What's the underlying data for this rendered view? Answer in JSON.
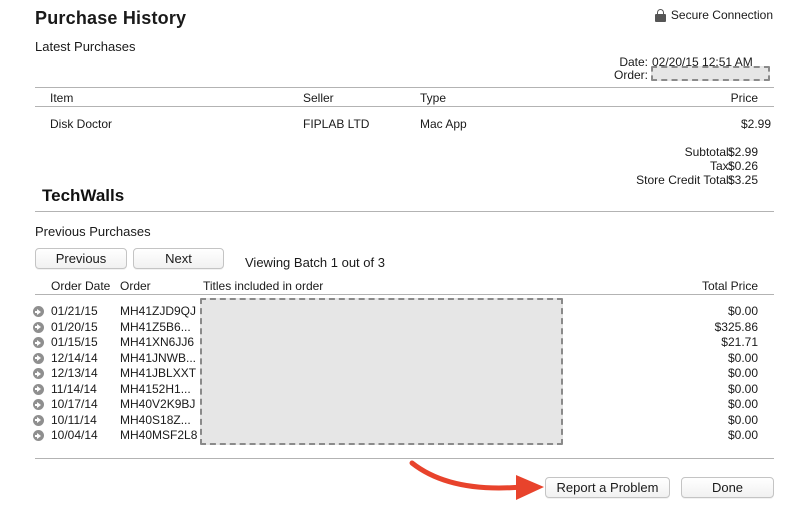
{
  "header": {
    "title": "Purchase History",
    "secure_label": "Secure Connection"
  },
  "latest": {
    "heading": "Latest Purchases",
    "date_label": "Date:",
    "date_value": "02/20/15 12:51 AM",
    "order_label": "Order:",
    "columns": {
      "item": "Item",
      "seller": "Seller",
      "type": "Type",
      "price": "Price"
    },
    "row": {
      "item": "Disk Doctor",
      "seller": "FIPLAB LTD",
      "type": "Mac App",
      "price": "$2.99"
    },
    "totals": {
      "subtotal_label": "Subtotal:",
      "subtotal": "$2.99",
      "tax_label": "Tax:",
      "tax": "$0.26",
      "credit_label": "Store Credit Total:",
      "credit": "$3.25"
    }
  },
  "watermark": "TechWalls",
  "previous": {
    "heading": "Previous Purchases",
    "prev_button": "Previous",
    "next_button": "Next",
    "batch_text": "Viewing Batch 1 out of 3",
    "columns": {
      "order_date": "Order Date",
      "order": "Order",
      "titles": "Titles included in order",
      "total": "Total Price"
    },
    "rows": [
      {
        "date": "01/21/15",
        "order": "MH41ZJD9QJ",
        "total": "$0.00"
      },
      {
        "date": "01/20/15",
        "order": "MH41Z5B6...",
        "total": "$325.86"
      },
      {
        "date": "01/15/15",
        "order": "MH41XN6JJ6",
        "total": "$21.71"
      },
      {
        "date": "12/14/14",
        "order": "MH41JNWB...",
        "total": "$0.00"
      },
      {
        "date": "12/13/14",
        "order": "MH41JBLXXT",
        "total": "$0.00"
      },
      {
        "date": "11/14/14",
        "order": "MH4152H1...",
        "total": "$0.00"
      },
      {
        "date": "10/17/14",
        "order": "MH40V2K9BJ",
        "total": "$0.00"
      },
      {
        "date": "10/11/14",
        "order": "MH40S18Z...",
        "total": "$0.00"
      },
      {
        "date": "10/04/14",
        "order": "MH40MSF2L8",
        "total": "$0.00"
      }
    ]
  },
  "footer": {
    "report_button": "Report a Problem",
    "done_button": "Done"
  },
  "colors": {
    "annotation_arrow": "#e8432c",
    "divider": "#b3b3b3"
  }
}
